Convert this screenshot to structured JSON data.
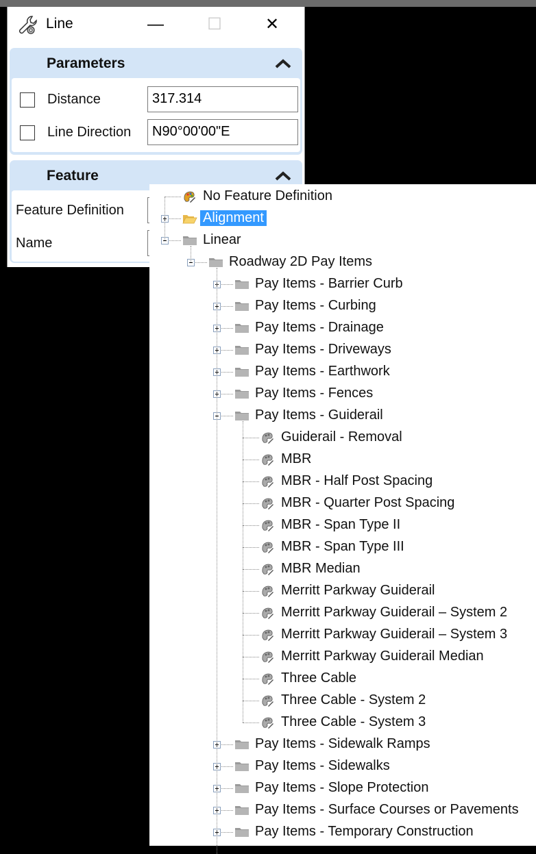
{
  "window": {
    "title": "Line",
    "minimize_glyph": "—",
    "maximize_glyph": "☐",
    "close_glyph": "✕"
  },
  "parameters": {
    "header": "Parameters",
    "distance_label": "Distance",
    "distance_value": "317.314",
    "direction_label": "Line Direction",
    "direction_value": "N90°00'00\"E"
  },
  "feature": {
    "header": "Feature",
    "definition_label": "Feature Definition",
    "name_label": "Name"
  },
  "tree": {
    "no_feature": "No Feature Definition",
    "alignment": "Alignment",
    "linear": "Linear",
    "roadway": "Roadway 2D Pay Items",
    "pay_items_before": [
      "Pay Items - Barrier Curb",
      "Pay Items - Curbing",
      "Pay Items - Drainage",
      "Pay Items - Driveways",
      "Pay Items - Earthwork",
      "Pay Items - Fences"
    ],
    "guiderail": "Pay Items - Guiderail",
    "guiderail_children": [
      "Guiderail - Removal",
      "MBR",
      "MBR - Half Post Spacing",
      "MBR - Quarter Post Spacing",
      "MBR - Span Type II",
      "MBR - Span Type III",
      "MBR Median",
      "Merritt Parkway Guiderail",
      "Merritt Parkway Guiderail – System 2",
      "Merritt Parkway Guiderail – System 3",
      "Merritt Parkway Guiderail Median",
      "Three Cable",
      "Three Cable - System 2",
      "Three Cable - System 3"
    ],
    "pay_items_after": [
      "Pay Items - Sidewalk Ramps",
      "Pay Items - Sidewalks",
      "Pay Items - Slope Protection",
      "Pay Items - Surface Courses or Pavements",
      "Pay Items - Temporary Construction"
    ]
  }
}
